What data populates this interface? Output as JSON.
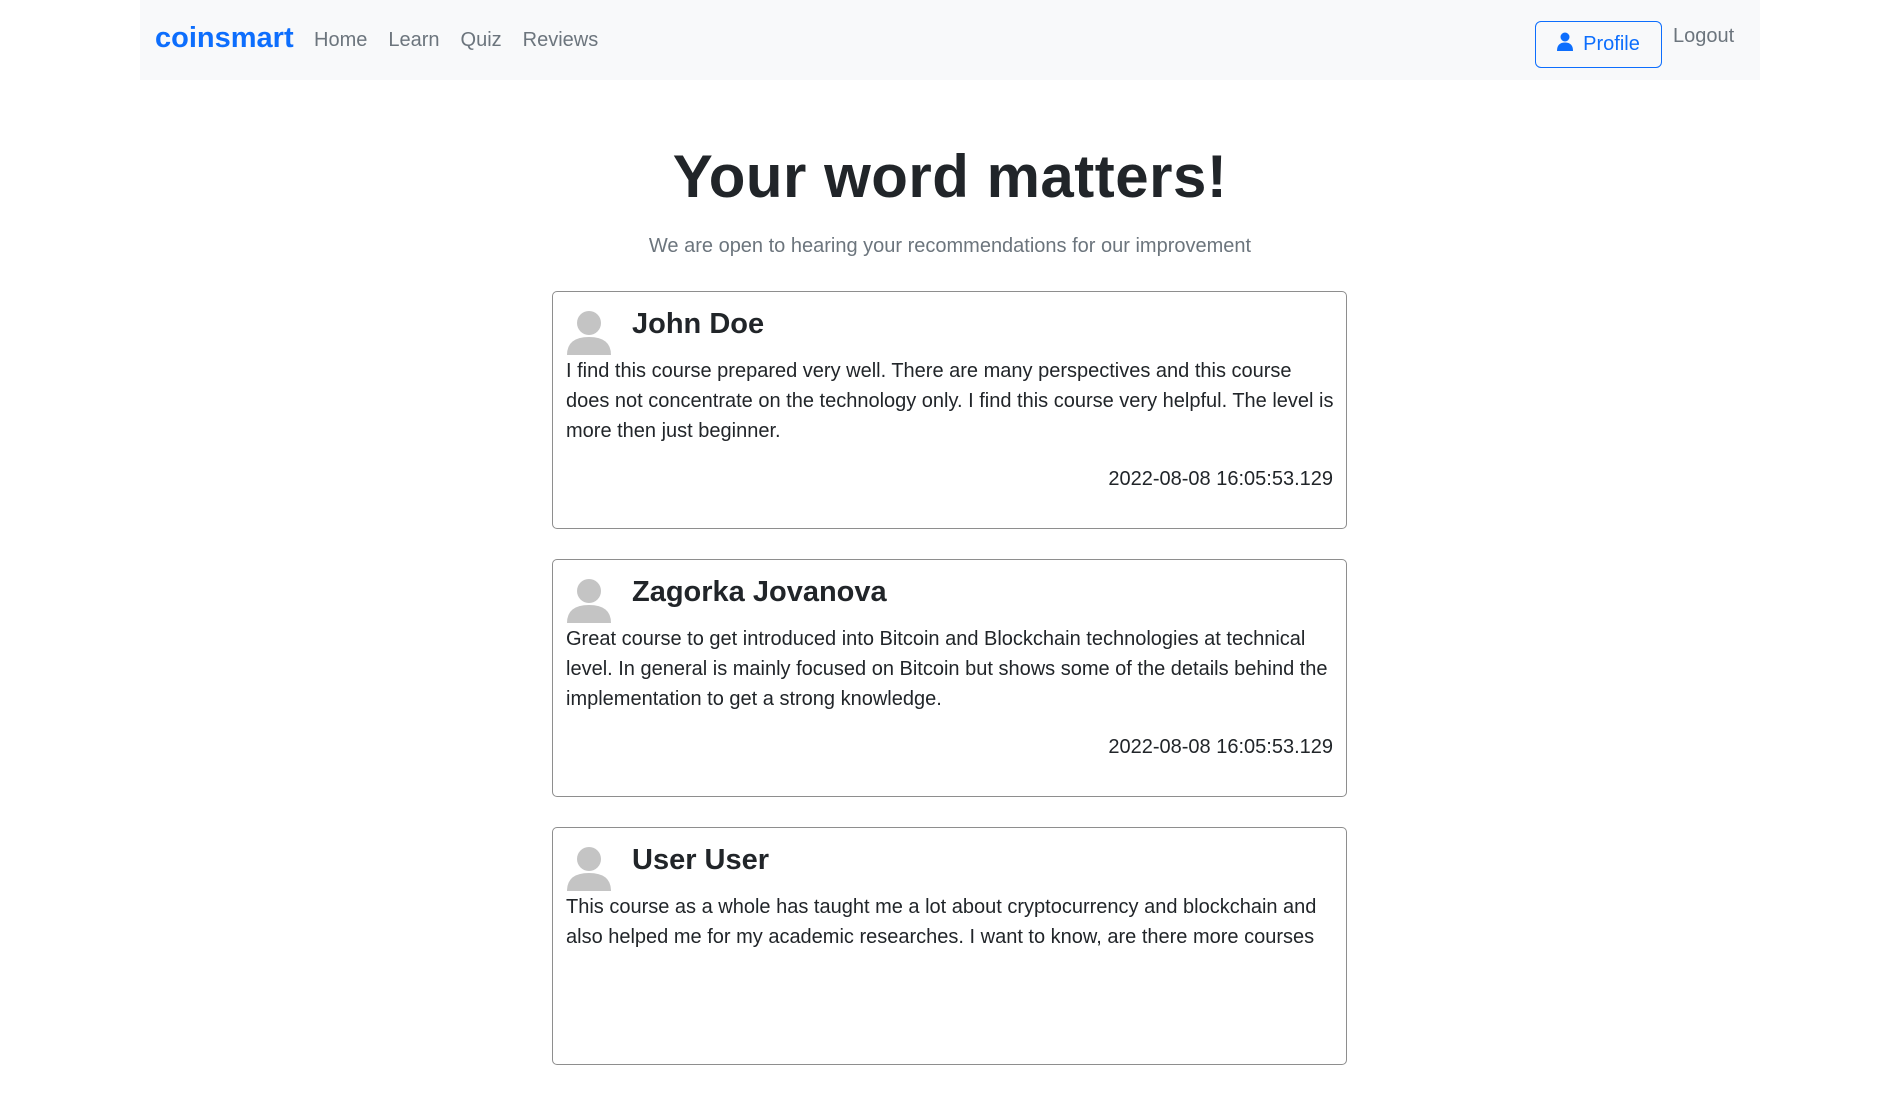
{
  "navbar": {
    "brand": "coinsmart",
    "links": [
      "Home",
      "Learn",
      "Quiz",
      "Reviews"
    ],
    "profile_label": "Profile",
    "logout_label": "Logout"
  },
  "hero": {
    "title": "Your word matters!",
    "subtitle": "We are open to hearing your recommendations for our improvement"
  },
  "reviews": [
    {
      "name": "John Doe",
      "text": "I find this course prepared very well. There are many perspectives and this course does not concentrate on the technology only. I find this course very helpful. The level is more then just beginner.",
      "date": "2022-08-08 16:05:53.129"
    },
    {
      "name": "Zagorka Jovanova",
      "text": "Great course to get introduced into Bitcoin and Blockchain technologies at technical level. In general is mainly focused on Bitcoin but shows some of the details behind the implementation to get a strong knowledge.",
      "date": "2022-08-08 16:05:53.129"
    },
    {
      "name": "User User",
      "text": "This course as a whole has taught me a lot about cryptocurrency and blockchain and also helped me for my academic researches. I want to know, are there more courses",
      "date": ""
    }
  ],
  "colors": {
    "brand": "#0d6efd",
    "muted": "#6c757d",
    "navbar_bg": "#f8f9fa",
    "avatar": "#c4c4c4"
  },
  "icons": {
    "profile": "user-icon",
    "avatar": "avatar-placeholder-icon"
  }
}
